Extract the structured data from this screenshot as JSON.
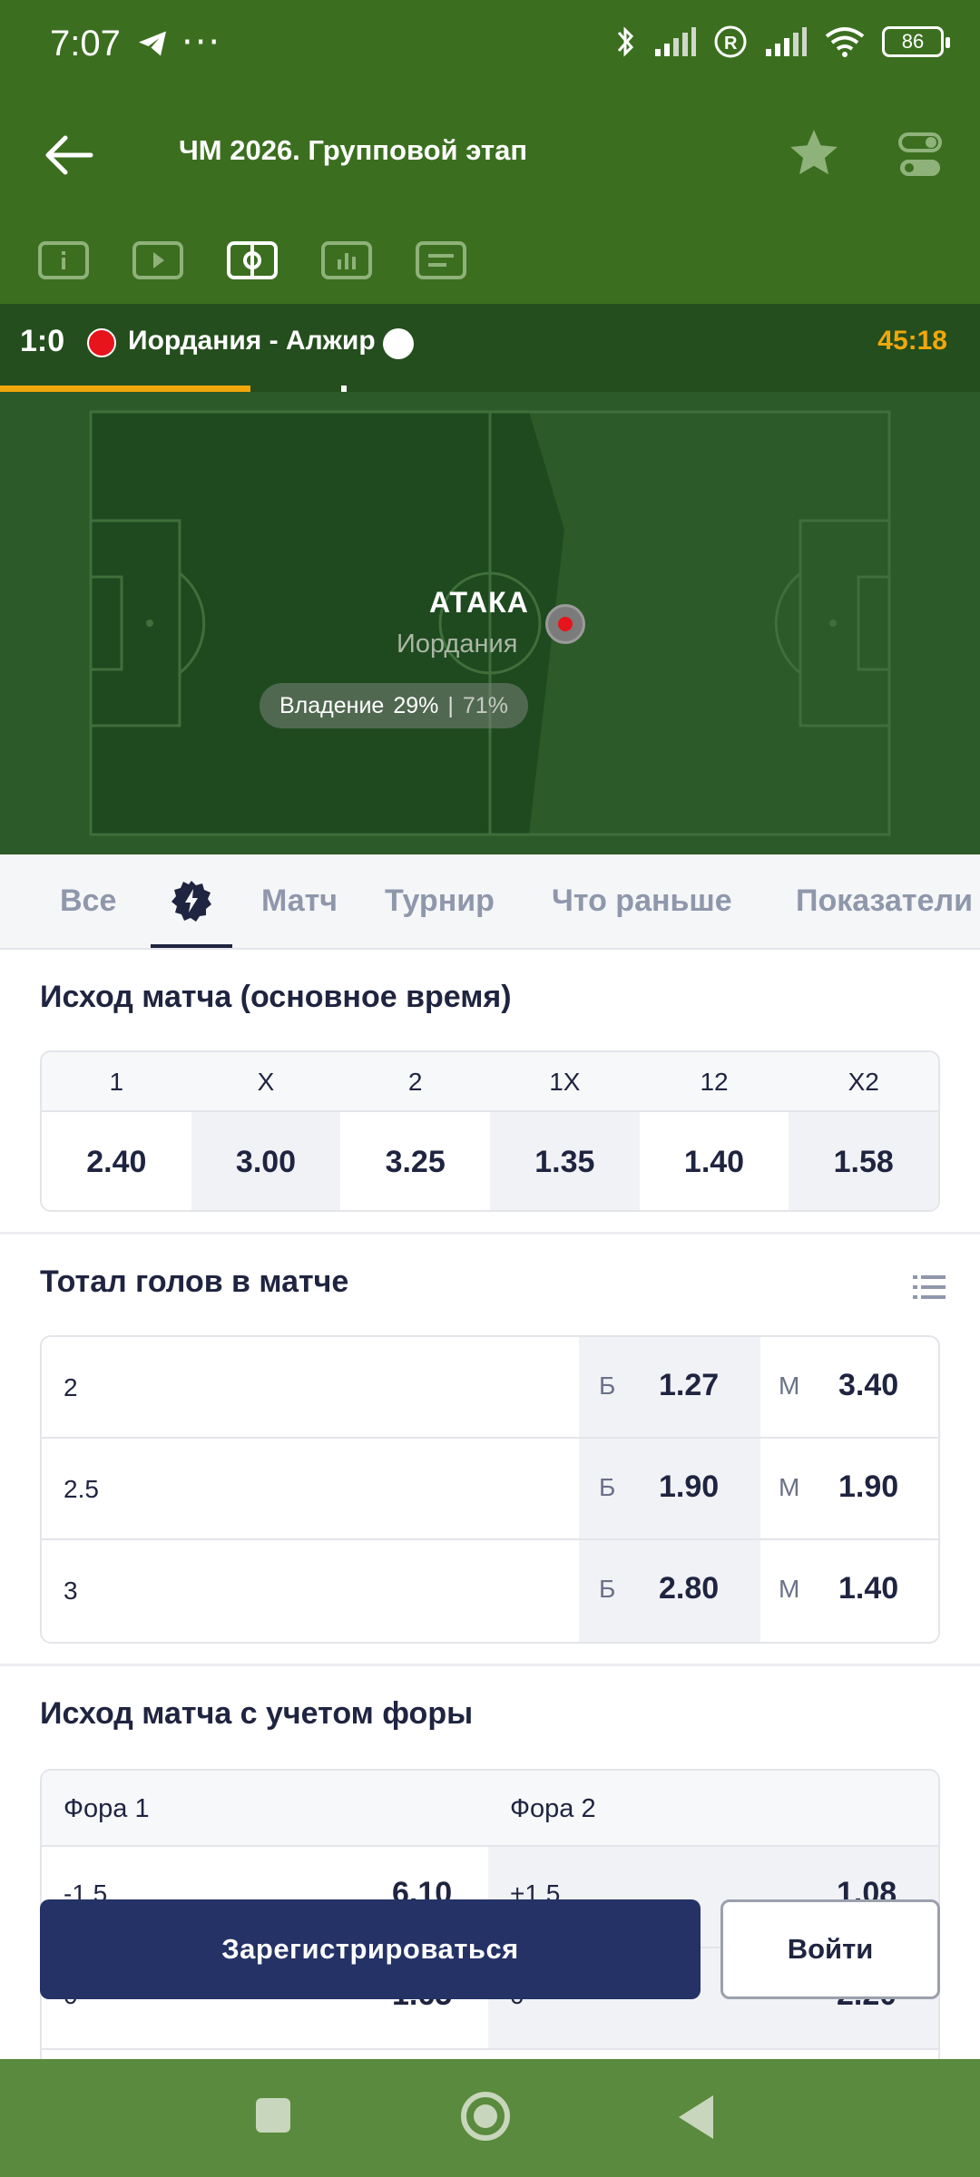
{
  "status_bar": {
    "time": "7:07",
    "dots": "···",
    "battery": "86",
    "icons": [
      "telegram-icon",
      "bluetooth-icon",
      "signal-icon",
      "roaming-icon",
      "signal-icon",
      "wifi-icon",
      "battery-icon"
    ]
  },
  "header": {
    "title": "ЧМ 2026. Групповой этап",
    "icons": [
      "back-arrow-icon",
      "star-icon",
      "settings-toggle-icon"
    ],
    "mode_tabs": [
      "info-icon",
      "video-icon",
      "pitch-icon",
      "stats-icon",
      "scoreboard-icon"
    ],
    "active_mode": 2
  },
  "match": {
    "score": "1:0",
    "teams": "Иордания - Алжир",
    "timer": "45:18",
    "progress": 0.5
  },
  "pitch": {
    "event": "АТАКА",
    "team": "Иордания",
    "possession_label": "Владение",
    "possession_home": "29%",
    "separator": "|",
    "possession_away": "71%"
  },
  "market_tabs": {
    "all": "Все",
    "match": "Матч",
    "tournament": "Турнир",
    "what_first": "Что раньше",
    "indicators": "Показатели",
    "active": "bolt-icon"
  },
  "outcome": {
    "title": "Исход матча (основное время)",
    "headers": [
      "1",
      "X",
      "2",
      "1X",
      "12",
      "X2"
    ],
    "odds": [
      "2.40",
      "3.00",
      "3.25",
      "1.35",
      "1.40",
      "1.58"
    ]
  },
  "totals": {
    "title": "Тотал голов в матче",
    "over_label": "Б",
    "under_label": "М",
    "rows": [
      {
        "line": "2",
        "over": "1.27",
        "under": "3.40"
      },
      {
        "line": "2.5",
        "over": "1.90",
        "under": "1.90"
      },
      {
        "line": "3",
        "over": "2.80",
        "under": "1.40"
      }
    ]
  },
  "handicap": {
    "title": "Исход матча с учетом форы",
    "col1": "Фора 1",
    "col2": "Фора 2",
    "rows": [
      {
        "h1": "-1.5",
        "o1": "6.10",
        "h2": "+1.5",
        "o2": "1.08"
      },
      {
        "h1": "0",
        "o1": "1.65",
        "h2": "0",
        "o2": "2.20"
      }
    ]
  },
  "actions": {
    "register": "Зарегистрироваться",
    "login": "Войти"
  },
  "colors": {
    "header_green": "#3b6f1f",
    "score_bar": "#244e1d",
    "accent_orange": "#f0a70c",
    "primary_button": "#243266"
  }
}
